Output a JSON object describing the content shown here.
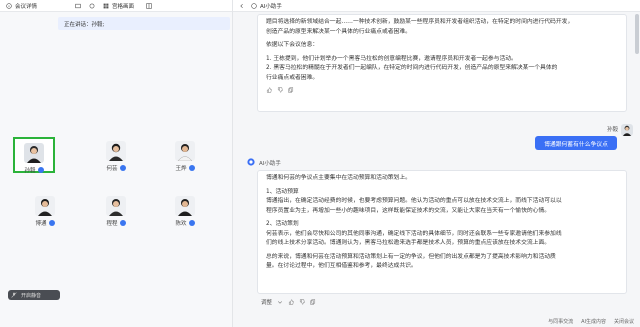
{
  "left": {
    "tab_details": "会议详情",
    "tab_gallery": "宫格画面",
    "banner": "正在讲话：孙毅;",
    "participants": [
      {
        "name": "孙毅",
        "selected": true
      },
      {
        "name": "何芸",
        "selected": false
      },
      {
        "name": "王烨",
        "selected": false
      },
      {
        "name": "博通",
        "selected": false
      },
      {
        "name": "程程",
        "selected": false
      },
      {
        "name": "陈欢",
        "selected": false
      }
    ],
    "mute_label": "开启静音"
  },
  "right": {
    "title": "AI小助手",
    "card1": {
      "line1": "题目将选择的新领域结合一起……一种技术创新，鼓励某一些程序员和开发者组织活动，在特定的时间内进行代码开发，",
      "line2": "创造产品的原型来解决某一个具体的行业痛点或者困难。",
      "line3": "依据以下会议信息：",
      "line4": "1. 王栋提到，他们计划举办一个黑客马拉松的创意编程比赛，邀请程序员和开发者一起参与活动。",
      "line5": "2. 黑客马拉松的精髓在于开发者们一起编队，在特定的时间内进行代码开发，创造产品的原型来解决某一个具体的",
      "line6": "行业痛点或者困难。"
    },
    "user_name": "孙毅",
    "user_question": "博通跟何蓄有什么争议点",
    "assistant_name": "AI小助手",
    "answer": {
      "p1": "博通和何芸的争议点主要集中在活动预算和活动策划上。",
      "h1": "1、活动预算",
      "p2": "博通指出，在确定活动经费的时候，也要考虑预算问题。他认为活动的重点可以放在技术交流上，而线下活动可以以",
      "p3": "程序员置业为主，再增加一些小的趣味项目，这样既能保证技术的交流，又能让大家在当天有一个愉快的心情。",
      "h2": "2、活动策划",
      "p4": "何芸表示，他们会尽快和公司的其他同事沟通，确定线下活动的具体细节，同时还会联系一些专家邀请他们来参加线",
      "p5": "们的线上技术分享活动。博通则认为，黑客马拉松邀来选手都是技术人员，预算的重点应该放在技术交流上面。",
      "p6": "总的来说，博通和何芸在活动预算和活动策划上有一定的争议，但他们的出发点都是为了提高技术影响力和活动质",
      "p7": "量。在讨论过程中，他们互相借鉴和参考，最终达成共识。"
    },
    "tune_label": "调整",
    "bottom_a": "与同事交流",
    "bottom_b": "AI生成内容",
    "bottom_c": "关闭会议"
  }
}
